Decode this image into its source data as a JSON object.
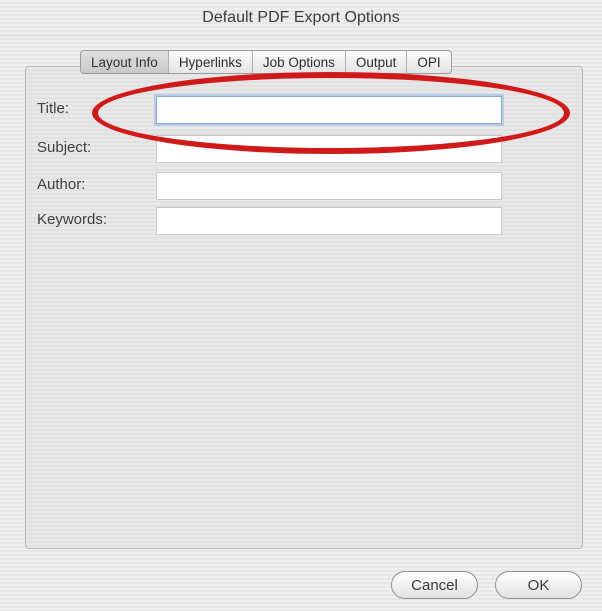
{
  "dialog": {
    "title": "Default PDF Export Options"
  },
  "tabs": [
    {
      "label": "Layout Info",
      "selected": true
    },
    {
      "label": "Hyperlinks",
      "selected": false
    },
    {
      "label": "Job Options",
      "selected": false
    },
    {
      "label": "Output",
      "selected": false
    },
    {
      "label": "OPI",
      "selected": false
    }
  ],
  "fields": [
    {
      "label": "Title:",
      "value": "",
      "focused": true
    },
    {
      "label": "Subject:",
      "value": "",
      "focused": false
    },
    {
      "label": "Author:",
      "value": "",
      "focused": false
    },
    {
      "label": "Keywords:",
      "value": "",
      "focused": false
    }
  ],
  "buttons": {
    "cancel_label": "Cancel",
    "ok_label": "OK"
  },
  "annotation": {
    "shape": "ellipse",
    "color": "#d01a1a"
  }
}
